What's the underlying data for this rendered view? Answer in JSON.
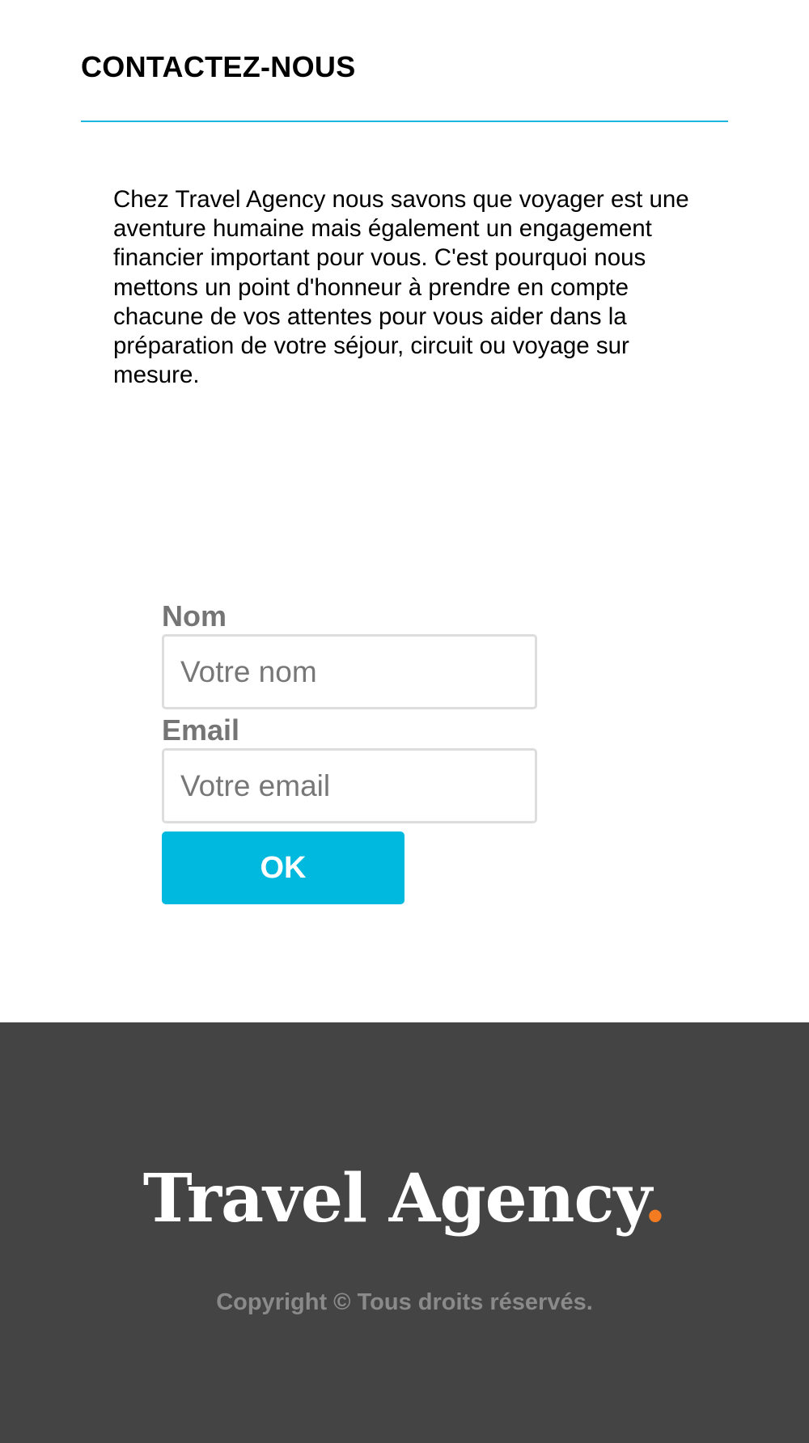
{
  "contact": {
    "title": "CONTACTEZ-NOUS",
    "intro": "Chez Travel Agency nous savons que voyager est une aventure humaine mais également un engagement financier important pour vous. C'est pourquoi nous mettons un point d'honneur à prendre en compte chacune de vos attentes pour vous aider dans la préparation de votre séjour, circuit ou voyage sur mesure."
  },
  "form": {
    "name_label": "Nom",
    "name_placeholder": "Votre nom",
    "name_value": "",
    "email_label": "Email",
    "email_placeholder": "Votre email",
    "email_value": "",
    "submit_label": "OK"
  },
  "footer": {
    "brand_name": "Travel Agency",
    "brand_dot": ".",
    "copyright": "Copyright © Tous droits réservés."
  },
  "colors": {
    "accent": "#00b9de",
    "rule": "#1fb6de",
    "footer_bg": "#444444",
    "brand_dot": "#f47b20",
    "label": "#757575"
  }
}
